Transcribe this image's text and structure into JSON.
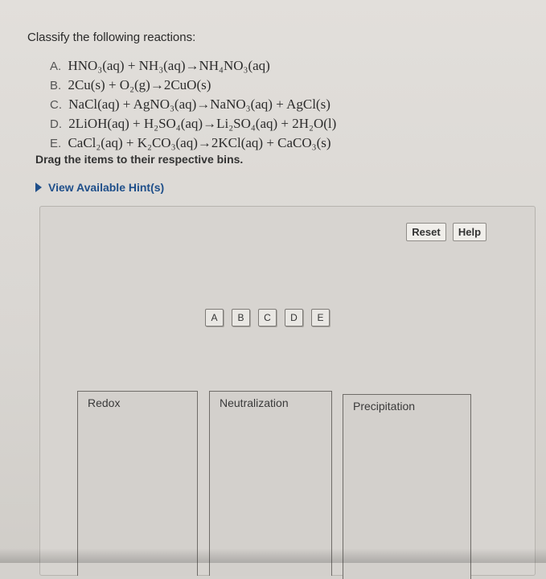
{
  "prompt": "Classify the following reactions:",
  "reactions": [
    {
      "letter": "A.",
      "equation": "HNO₃(aq) + NH₃(aq)→NH₄NO₃(aq)"
    },
    {
      "letter": "B.",
      "equation": "2Cu(s) + O₂(g)→2CuO(s)"
    },
    {
      "letter": "C.",
      "equation": "NaCl(aq) + AgNO₃(aq)→NaNO₃(aq) + AgCl(s)"
    },
    {
      "letter": "D.",
      "equation": "2LiOH(aq) + H₂SO₄(aq)→Li₂SO₄(aq) + 2H₂O(l)"
    },
    {
      "letter": "E.",
      "equation": "CaCl₂(aq) + K₂CO₃(aq)→2KCl(aq) + CaCO₃(s)"
    }
  ],
  "instruction": "Drag the items to their respective bins.",
  "hint_label": "View Available Hint(s)",
  "buttons": {
    "reset": "Reset",
    "help": "Help"
  },
  "tiles": [
    "A",
    "B",
    "C",
    "D",
    "E"
  ],
  "bins": {
    "redox": "Redox",
    "neutralization": "Neutralization",
    "precipitation": "Precipitation"
  }
}
